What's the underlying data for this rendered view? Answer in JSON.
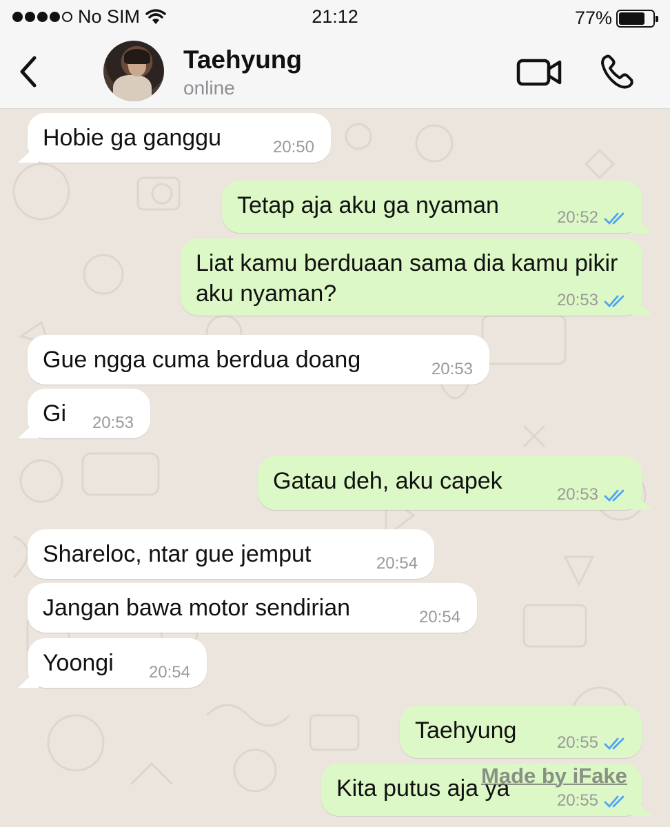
{
  "status_bar": {
    "carrier": "No SIM",
    "time": "21:12",
    "battery_percent": "77%",
    "battery_level": 0.77,
    "icons": [
      "signal-dots",
      "wifi-icon",
      "battery-icon"
    ]
  },
  "header": {
    "contact_name": "Taehyung",
    "contact_status": "online",
    "icons": [
      "back-chevron-icon",
      "video-camera-icon",
      "phone-icon"
    ]
  },
  "messages": [
    {
      "direction": "in",
      "text": "Hobie ga ganggu",
      "time": "20:50"
    },
    {
      "direction": "out",
      "text": "Tetap aja aku ga nyaman",
      "time": "20:52",
      "read": true
    },
    {
      "direction": "out",
      "text": "Liat kamu berduaan sama dia kamu pikir aku nyaman?",
      "time": "20:53",
      "read": true
    },
    {
      "direction": "in",
      "text": "Gue ngga cuma berdua doang",
      "time": "20:53"
    },
    {
      "direction": "in",
      "text": "Gi",
      "time": "20:53"
    },
    {
      "direction": "out",
      "text": "Gatau deh, aku capek",
      "time": "20:53",
      "read": true
    },
    {
      "direction": "in",
      "text": "Shareloc, ntar gue jemput",
      "time": "20:54"
    },
    {
      "direction": "in",
      "text": "Jangan bawa motor sendirian",
      "time": "20:54"
    },
    {
      "direction": "in",
      "text": "Yoongi",
      "time": "20:54"
    },
    {
      "direction": "out",
      "text": "Taehyung",
      "time": "20:55",
      "read": true
    },
    {
      "direction": "out",
      "text": "Kita putus aja ya",
      "time": "20:55",
      "read": true
    }
  ],
  "watermark": "Made by iFake",
  "colors": {
    "incoming_bubble": "#ffffff",
    "outgoing_bubble": "#dcf8c6",
    "read_ticks": "#4fa3f7",
    "chat_background": "#ebe5de",
    "header_background": "#f6f6f6"
  }
}
